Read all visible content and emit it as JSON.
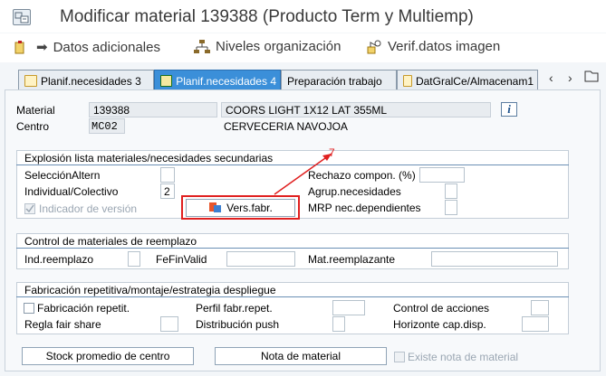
{
  "window": {
    "title": "Modificar material 139388 (Producto Term y Multiemp)"
  },
  "toolbar": {
    "additional_data": "Datos adicionales",
    "org_levels": "Niveles organización",
    "check_screen_data": "Verif.datos imagen"
  },
  "tabs": [
    {
      "label": "Planif.necesidades 3",
      "active": false
    },
    {
      "label": "Planif.necesidades 4",
      "active": true
    },
    {
      "label": "Preparación trabajo",
      "active": false
    },
    {
      "label": "DatGralCe/Almacenam1",
      "active": false
    }
  ],
  "header": {
    "material_label": "Material",
    "material_value": "139388",
    "material_desc": "COORS LIGHT  1X12 LAT 355ML",
    "plant_label": "Centro",
    "plant_value": "MC02",
    "plant_desc": "CERVECERIA NAVOJOA"
  },
  "bom_group": {
    "title": "Explosión lista materiales/necesidades secundarias",
    "selection_method_label": "SelecciónAltern",
    "selection_method_value": "",
    "individual_collective_label": "Individual/Colectivo",
    "individual_collective_value": "2",
    "version_indicator_label": "Indicador de versión",
    "version_indicator_checked": true,
    "prod_versions_button": "Vers.fabr.",
    "component_scrap_label": "Rechazo compon. (%)",
    "component_scrap_value": "",
    "requirements_group_label": "Agrup.necesidades",
    "requirements_group_value": "",
    "mrp_dependent_label": "MRP nec.dependientes",
    "mrp_dependent_value": ""
  },
  "annotation": {
    "label": "7",
    "color": "#e02020"
  },
  "discontinued_group": {
    "title": "Control de materiales de reemplazo",
    "discontinuation_label": "Ind.reemplazo",
    "discontinuation_value": "",
    "eff_out_label": "FeFinValid",
    "eff_out_value": "",
    "follow_up_label": "Mat.reemplazante",
    "follow_up_value": ""
  },
  "repetitive_group": {
    "title": "Fabricación repetitiva/montaje/estrategia despliegue",
    "repetitive_mfg_label": "Fabricación repetit.",
    "repetitive_mfg_checked": false,
    "rem_profile_label": "Perfil fabr.repet.",
    "rem_profile_value": "",
    "action_control_label": "Control de acciones",
    "action_control_value": "",
    "fair_share_label": "Regla fair share",
    "fair_share_value": "",
    "push_distribution_label": "Distribución push",
    "push_distribution_value": "",
    "capacity_horizon_label": "Horizonte cap.disp.",
    "capacity_horizon_value": ""
  },
  "footer": {
    "avg_stock_button": "Stock promedio de centro",
    "material_note_button": "Nota de material",
    "note_exists_label": "Existe nota de material"
  }
}
